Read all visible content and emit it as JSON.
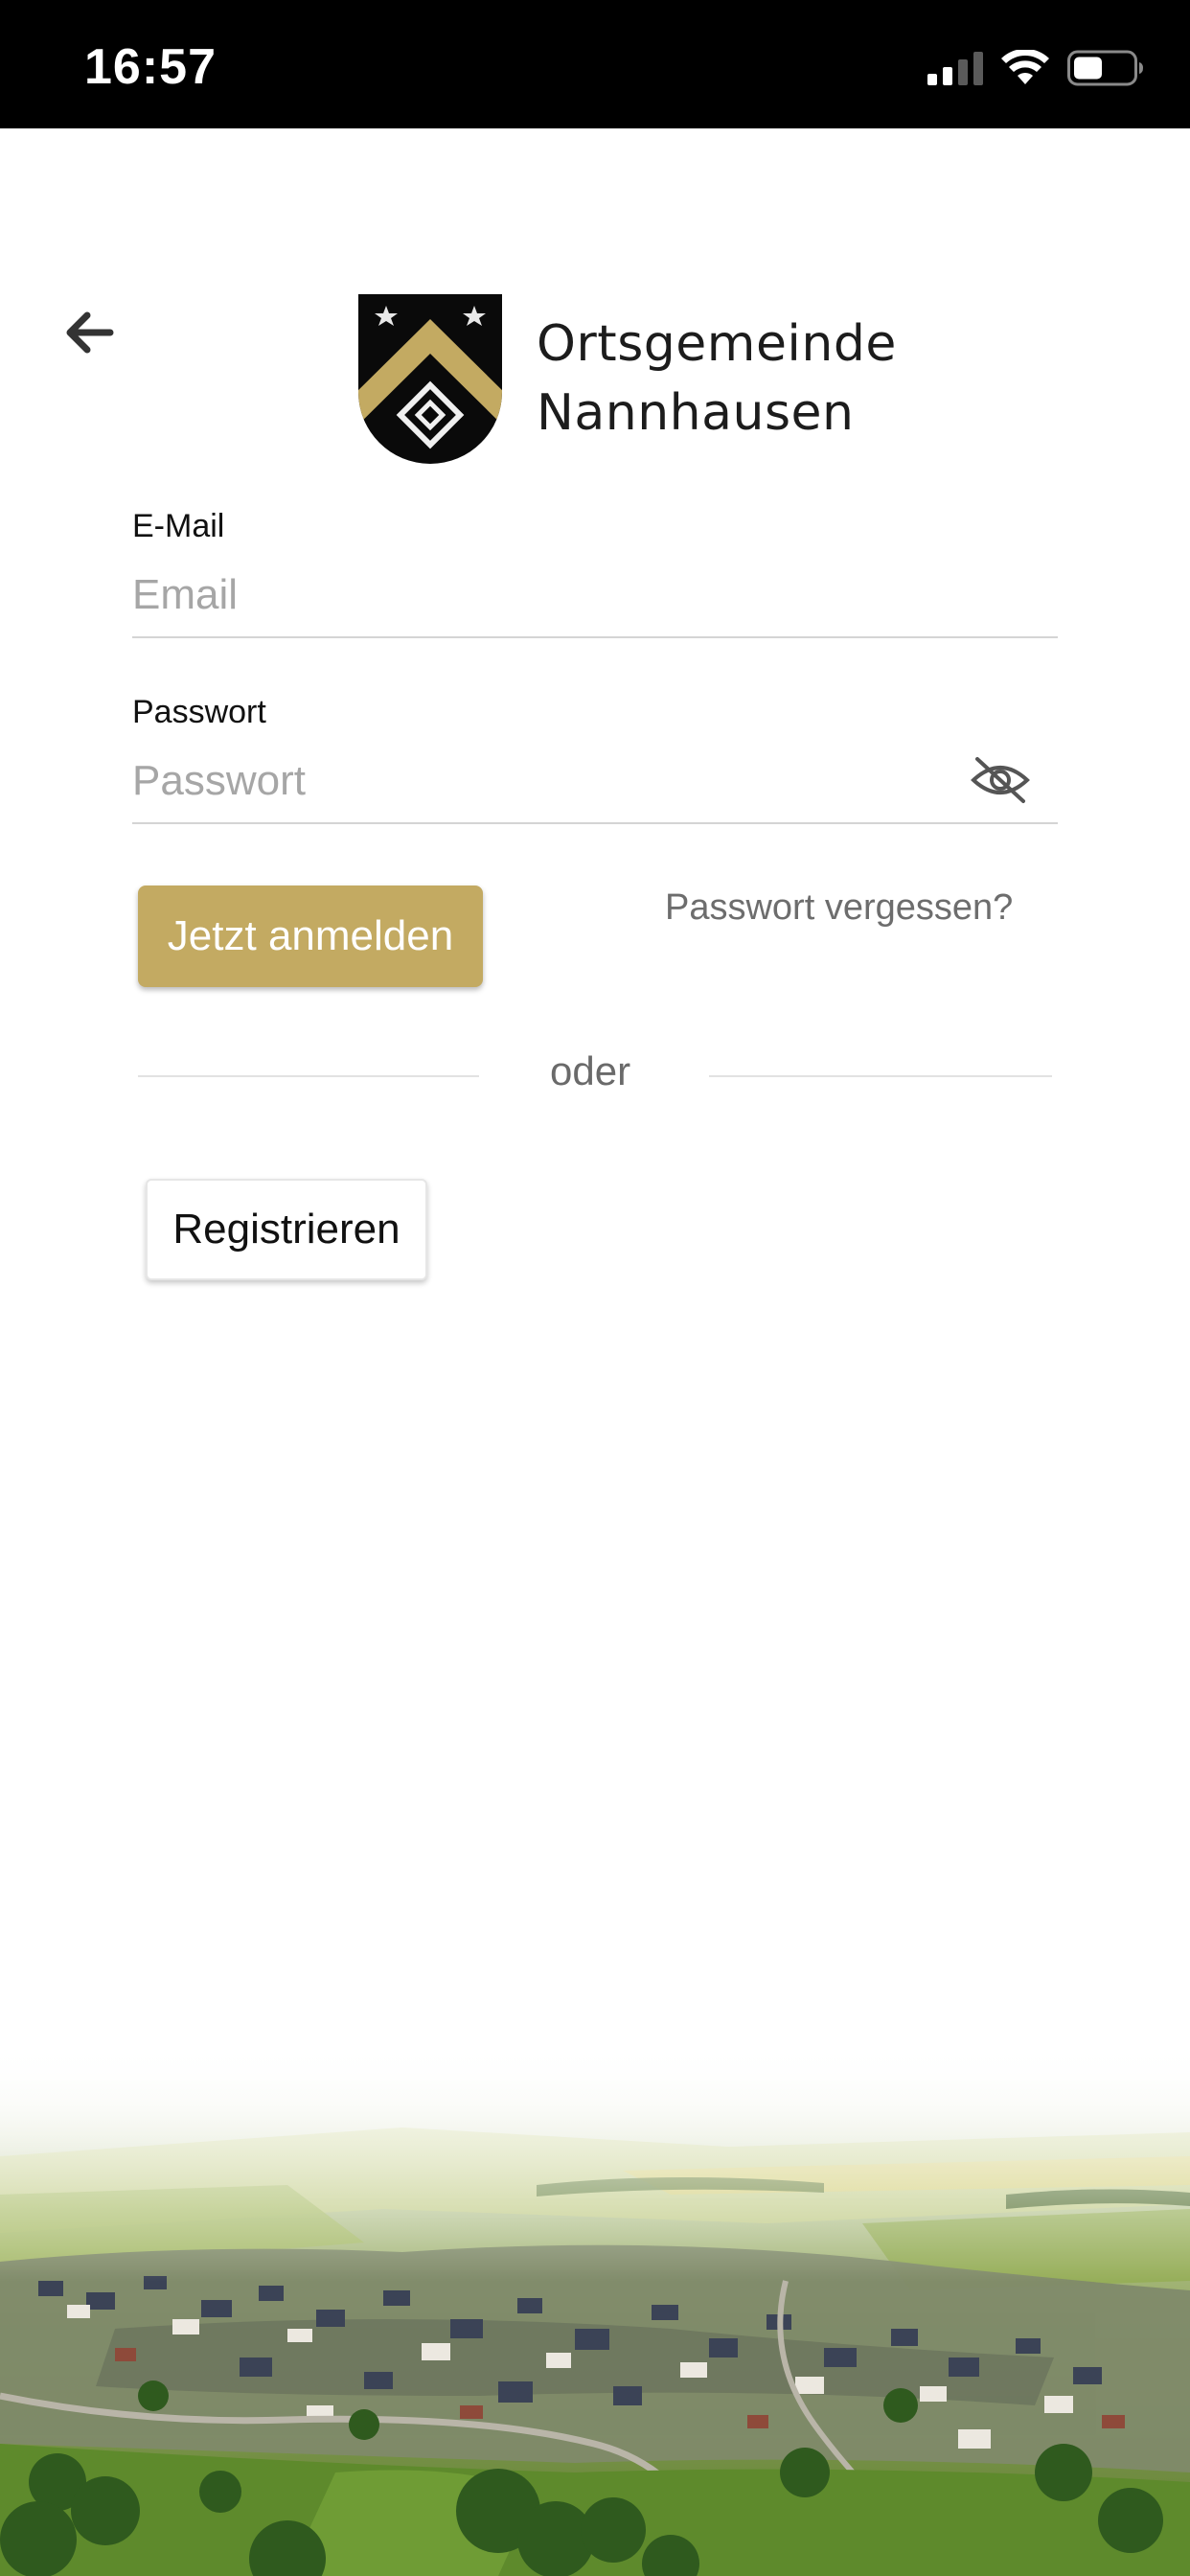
{
  "status_bar": {
    "time": "16:57",
    "icons": [
      "cellular-signal-icon",
      "wifi-icon",
      "battery-icon"
    ]
  },
  "header": {
    "back_icon": "arrow-left-icon",
    "logo_line1": "Ortsgemeinde",
    "logo_line2": "Nannhausen"
  },
  "form": {
    "email_label": "E-Mail",
    "email_placeholder": "Email",
    "password_label": "Passwort",
    "password_placeholder": "Passwort",
    "password_toggle_icon": "eye-slash-icon",
    "login_label": "Jetzt anmelden",
    "forgot_label": "Passwort vergessen?",
    "divider_text": "oder",
    "register_label": "Registrieren"
  },
  "colors": {
    "accent": "#c3aa62",
    "status_bar": "#000000",
    "background": "#ffffff"
  }
}
